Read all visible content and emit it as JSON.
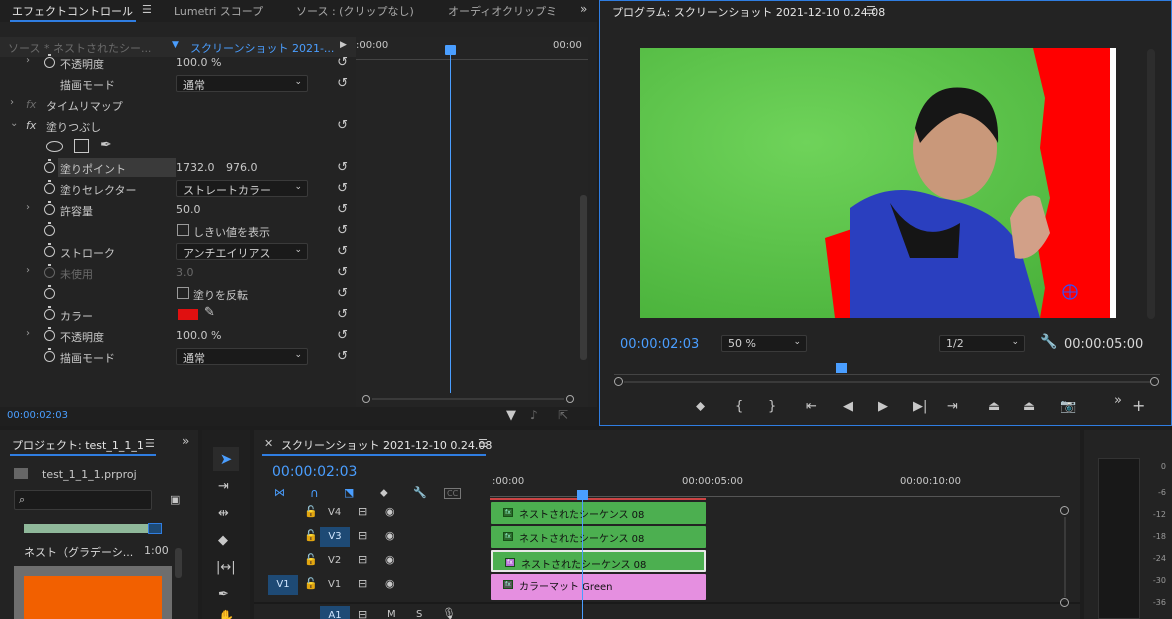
{
  "effect_controls": {
    "tabs": [
      "エフェクトコントロール",
      "Lumetri スコープ",
      "ソース : (クリップなし)",
      "オーディオクリップミ"
    ],
    "source_label": "ソース * ネストされたシー...",
    "sequence_label": "スクリーンショット 2021-...",
    "ruler_start": ":00:00",
    "ruler_end": "00:00",
    "rows": {
      "opacity1": {
        "label": "不透明度",
        "value": "100.0 %"
      },
      "blend1": {
        "label": "描画モード",
        "value": "通常"
      },
      "time_remap": {
        "label": "タイムリマップ"
      },
      "fill": {
        "label": "塗りつぶし"
      },
      "fill_point": {
        "label": "塗りポイント",
        "x": "1732.0",
        "y": "976.0"
      },
      "fill_selector": {
        "label": "塗りセレクター",
        "value": "ストレートカラー"
      },
      "tolerance": {
        "label": "許容量",
        "value": "50.0"
      },
      "show_threshold": {
        "label": "しきい値を表示"
      },
      "stroke": {
        "label": "ストローク",
        "value": "アンチエイリアス"
      },
      "unused": {
        "label": "未使用",
        "value": "3.0"
      },
      "invert_fill": {
        "label": "塗りを反転"
      },
      "color": {
        "label": "カラー",
        "swatch": "#e01010"
      },
      "opacity2": {
        "label": "不透明度",
        "value": "100.0 %"
      },
      "blend2": {
        "label": "描画モード",
        "value": "通常"
      }
    },
    "fx_glyph": "fx",
    "timecode": "00:00:02:03"
  },
  "program": {
    "title": "プログラム: スクリーンショット 2021-12-10 0.24.08",
    "timecode": "00:00:02:03",
    "zoom": "50 %",
    "resolution": "1/2",
    "duration": "00:00:05:00"
  },
  "project": {
    "title": "プロジェクト: test_1_1_1",
    "file": "test_1_1_1.prproj",
    "item_name": "ネスト（グラデーシ...",
    "item_duration": "1:00"
  },
  "timeline": {
    "title": "スクリーンショット 2021-12-10 0.24.08",
    "timecode": "00:00:02:03",
    "ruler": [
      ":00:00",
      "00:00:05:00",
      "00:00:10:00"
    ],
    "tracks": [
      {
        "name": "V4",
        "clip": "ネストされたシーケンス 08"
      },
      {
        "name": "V3",
        "clip": "ネストされたシーケンス 08"
      },
      {
        "name": "V2",
        "clip": "ネストされたシーケンス 08"
      },
      {
        "name": "V1",
        "clip": "カラーマット Green"
      },
      {
        "name": "A1",
        "clip": ""
      }
    ],
    "src_patch_v": "V1",
    "src_patch_a": "A1",
    "audio_m": "M",
    "audio_s": "S",
    "cc_label": "CC"
  },
  "meter": {
    "labels": [
      "0",
      "-6",
      "-12",
      "-18",
      "-24",
      "-30",
      "-36"
    ]
  },
  "colors": {
    "accent": "#2f7de1",
    "timecode": "#4a9eff",
    "clip_green": "#4caf50",
    "clip_pink": "#e58fe0",
    "panel_bg": "#232323"
  }
}
